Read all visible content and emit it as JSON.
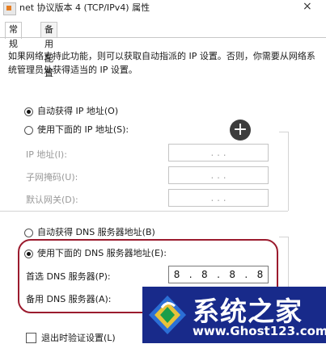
{
  "window": {
    "title": "net 协议版本 4 (TCP/IPv4) 属性",
    "close_glyph": "×"
  },
  "tabs": [
    {
      "label": "常规",
      "active": true
    },
    {
      "label": "备用配置",
      "active": false
    }
  ],
  "description": "如果网络支持此功能，则可以获取自动指派的 IP 设置。否则，你需要从网络系统管理员处获得适当的 IP 设置。",
  "ip_section": {
    "auto_option": {
      "label": "自动获得 IP 地址(O)",
      "checked": true
    },
    "manual_option": {
      "label": "使用下面的 IP 地址(S):",
      "checked": false
    },
    "fields": [
      {
        "label": "IP 地址(I):",
        "value": ". . ."
      },
      {
        "label": "子网掩码(U):",
        "value": ". . ."
      },
      {
        "label": "默认网关(D):",
        "value": ". . ."
      }
    ]
  },
  "dns_section": {
    "auto_option": {
      "label": "自动获得 DNS 服务器地址(B)",
      "checked": false
    },
    "manual_option": {
      "label": "使用下面的 DNS 服务器地址(E):",
      "checked": true
    },
    "preferred": {
      "label": "首选 DNS 服务器(P):",
      "octets": [
        "8",
        "8",
        "8",
        "8"
      ]
    },
    "alternate": {
      "label": "备用 DNS 服务器(A):",
      "value": ". . ."
    }
  },
  "validate_checkbox": {
    "label": "退出时验证设置(L)",
    "checked": false
  },
  "plus_glyph": "+",
  "watermark": {
    "title": "系统之家",
    "url": "www.Ghost123.com"
  },
  "colors": {
    "highlight_ring": "#9b1b2e",
    "watermark_bg": "#182a8a"
  }
}
